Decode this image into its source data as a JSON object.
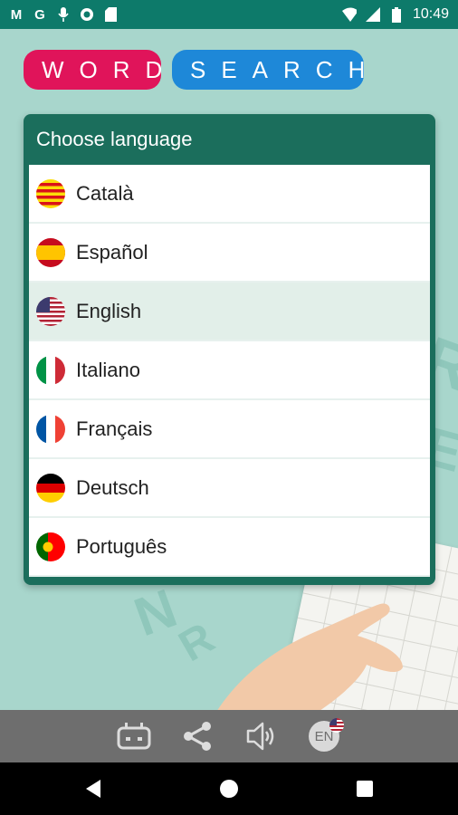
{
  "status_bar": {
    "time": "10:49",
    "left_icons": [
      "gmail-icon",
      "google-icon",
      "mic-icon",
      "circle-icon",
      "sd-card-icon"
    ],
    "right_icons": [
      "wifi-icon",
      "signal-icon",
      "battery-icon"
    ],
    "gmail_glyph": "M",
    "google_glyph": "G"
  },
  "title": {
    "word": "WORD",
    "search": "SEARCH",
    "word_color": "#e0145a",
    "search_color": "#1e88d8"
  },
  "dialog": {
    "title": "Choose language",
    "header_color": "#1b6e5c",
    "languages": [
      {
        "label": "Català",
        "flag": "catalan-flag-icon"
      },
      {
        "label": "Español",
        "flag": "spain-flag-icon"
      },
      {
        "label": "English",
        "flag": "usa-flag-icon",
        "selected": true
      },
      {
        "label": "Italiano",
        "flag": "italy-flag-icon"
      },
      {
        "label": "Français",
        "flag": "france-flag-icon"
      },
      {
        "label": "Deutsch",
        "flag": "germany-flag-icon"
      },
      {
        "label": "Português",
        "flag": "portugal-flag-icon"
      }
    ]
  },
  "toolbar": {
    "icons": [
      "gamepad-icon",
      "share-icon",
      "sound-icon",
      "language-icon"
    ],
    "language_code": "EN"
  },
  "nav_bar": {
    "icons": [
      "back-icon",
      "home-icon",
      "recents-icon"
    ]
  }
}
